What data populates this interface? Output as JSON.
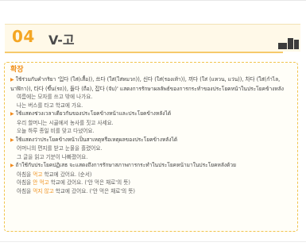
{
  "header": {
    "number": "04",
    "title": "V-고"
  },
  "box": {
    "title": "확장",
    "p1_text": "ใช้ร่วมกับคำกริยา '입다 (ใส่(เสื้อ)), 쓰다 (ใส่(ใส่หมวก)), 신다 (ใส่(รองเท้า)), 끼다 (ใส่ (แหวน, แว่น)), 차다 (ใส่(กำไล, นาฬิกา)), 타다 (ขึ้น(รถ)), 들다 (ถือ), 잡다 (จับ)' แสดงการรักษาผลลัพธ์ของการกระทำของประโยคหน้าในประโยคข้างหลัง",
    "p1_ex": [
      "여름에는 모자를 쓰고 밖에 나가요.",
      "나는 버스를 타고 학교에 가요."
    ],
    "p2_text": "ใช้แสดงช่วงเวลาเดียวกันของประโยคข้างหน้าและประโยคข้างหลังได้",
    "p2_ex": [
      "우리 할머니는 시골에서 농사를 짓고 사세요.",
      "오늘 하루 종일 비를 맞고 다녔어요."
    ],
    "p3_text": "ใช้แสดงว่าประโยคข้างหน้าเป็นสาเหตุหรือเหตุผลของประโยคข้างหลังได้",
    "p3_ex": [
      "어머니의 편지를 받고 눈물을 흘렸어요.",
      "그 글을 읽고 기분이 나빠졌어요."
    ],
    "p4_text": "ถ้าใช้กับประโยคปฏิเสธ จะแสดงถึงการรักษาสภาพการกระทำในประโยคหน้ามาในประโยคหลังด้วย",
    "p4_ex": [
      {
        "pre": "아침을 ",
        "hl": "먹고",
        "post": " 학교에 갔어요. (순서)"
      },
      {
        "pre": "아침을 ",
        "hl": "안 먹고",
        "post": " 학교에 갔어요. ('안 먹은 채로'의 뜻)"
      },
      {
        "pre": "아침을 ",
        "hl": "먹지 않고",
        "post": " 학교에 갔어요. ('안 먹은 채로'의 뜻)"
      }
    ]
  }
}
